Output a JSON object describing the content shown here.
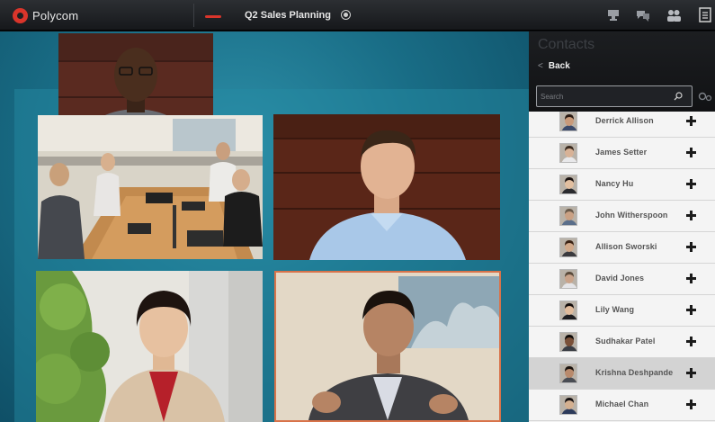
{
  "app": {
    "brand": "Polycom",
    "call_title": "Q2 Sales Planning"
  },
  "toolbar": {
    "icons": [
      "end-call-icon",
      "record-icon",
      "chat-icon",
      "contacts-icon",
      "more-icon"
    ]
  },
  "contacts": {
    "title": "Contacts",
    "back_label": "Back",
    "search_placeholder": "Search",
    "items": [
      {
        "name": "Derrick Allison",
        "selected": false
      },
      {
        "name": "James Setter",
        "selected": false
      },
      {
        "name": "Nancy Hu",
        "selected": false
      },
      {
        "name": "John Witherspoon",
        "selected": false
      },
      {
        "name": "Allison Sworski",
        "selected": false
      },
      {
        "name": "David Jones",
        "selected": false
      },
      {
        "name": "Lily Wang",
        "selected": false
      },
      {
        "name": "Sudhakar Patel",
        "selected": false
      },
      {
        "name": "Krishna Deshpande",
        "selected": true
      },
      {
        "name": "Michael Chan",
        "selected": false
      }
    ]
  },
  "colors": {
    "accent": "#d9352b",
    "stage": "#196d86",
    "active_speaker_border": "#d8734a"
  }
}
